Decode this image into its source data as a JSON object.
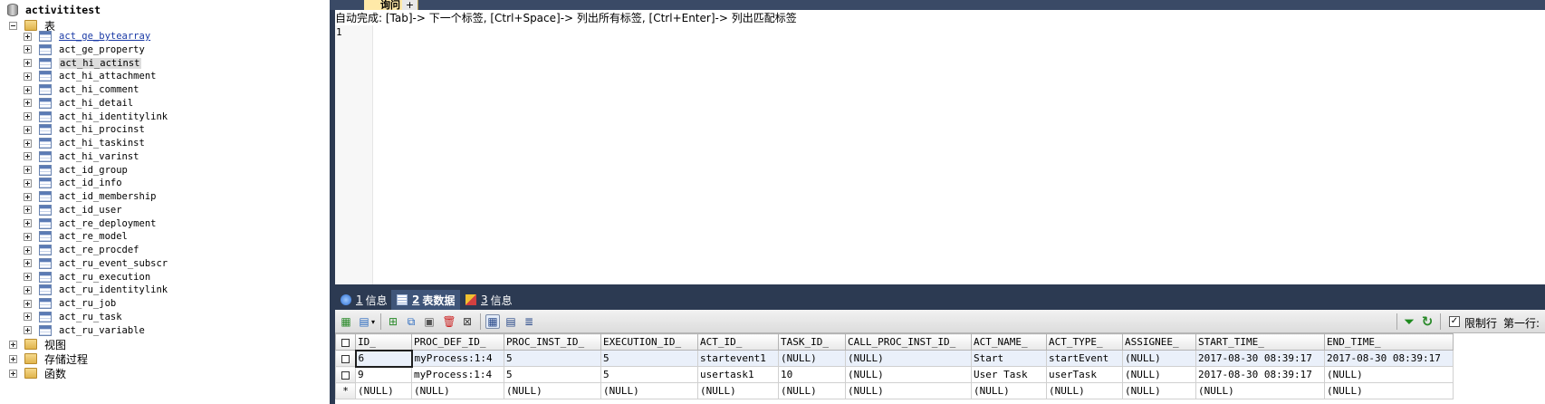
{
  "tree": {
    "database": "activititest",
    "tables_folder": "表",
    "tables": [
      "act_ge_bytearray",
      "act_ge_property",
      "act_hi_actinst",
      "act_hi_attachment",
      "act_hi_comment",
      "act_hi_detail",
      "act_hi_identitylink",
      "act_hi_procinst",
      "act_hi_taskinst",
      "act_hi_varinst",
      "act_id_group",
      "act_id_info",
      "act_id_membership",
      "act_id_user",
      "act_re_deployment",
      "act_re_model",
      "act_re_procdef",
      "act_ru_event_subscr",
      "act_ru_execution",
      "act_ru_identitylink",
      "act_ru_job",
      "act_ru_task",
      "act_ru_variable"
    ],
    "selected_table": "act_hi_actinst",
    "linked_table": "act_ge_bytearray",
    "views_folder": "视图",
    "procs_folder": "存储过程",
    "funcs_folder": "函数"
  },
  "query": {
    "tab_label": "询问",
    "add_tab_label": "+",
    "hint": "自动完成: [Tab]-> 下一个标签, [Ctrl+Space]-> 列出所有标签, [Ctrl+Enter]-> 列出匹配标签",
    "line_number": "1"
  },
  "results": {
    "tabs": [
      {
        "num": "1",
        "label": "信息"
      },
      {
        "num": "2",
        "label": "表数据"
      },
      {
        "num": "3",
        "label": "信息"
      }
    ],
    "limit_label": "限制行",
    "first_row_label": "第一行:",
    "limit_checked": "✓",
    "columns": [
      "ID_",
      "PROC_DEF_ID_",
      "PROC_INST_ID_",
      "EXECUTION_ID_",
      "ACT_ID_",
      "TASK_ID_",
      "CALL_PROC_INST_ID_",
      "ACT_NAME_",
      "ACT_TYPE_",
      "ASSIGNEE_",
      "START_TIME_",
      "END_TIME_"
    ],
    "rows": [
      [
        "6",
        "myProcess:1:4",
        "5",
        "5",
        "startevent1",
        "(NULL)",
        "(NULL)",
        "Start",
        "startEvent",
        "(NULL)",
        "2017-08-30 08:39:17",
        "2017-08-30 08:39:17"
      ],
      [
        "9",
        "myProcess:1:4",
        "5",
        "5",
        "usertask1",
        "10",
        "(NULL)",
        "User Task",
        "userTask",
        "(NULL)",
        "2017-08-30 08:39:17",
        "(NULL)"
      ],
      [
        "(NULL)",
        "(NULL)",
        "(NULL)",
        "(NULL)",
        "(NULL)",
        "(NULL)",
        "(NULL)",
        "(NULL)",
        "(NULL)",
        "(NULL)",
        "(NULL)",
        "(NULL)"
      ]
    ],
    "new_row_marker": "*"
  }
}
